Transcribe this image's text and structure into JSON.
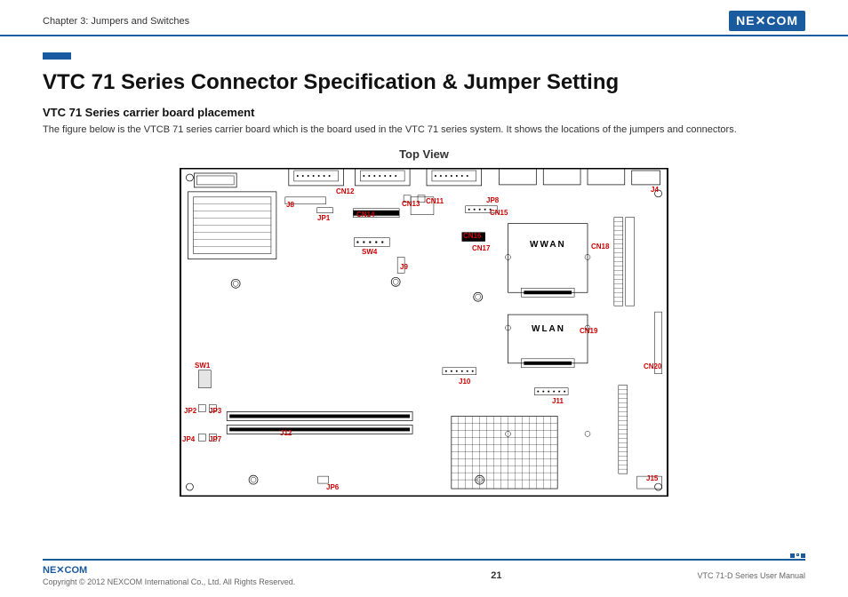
{
  "header": {
    "chapter_title": "Chapter 3: Jumpers and Switches",
    "logo_text": "NE✕COM"
  },
  "content": {
    "main_title": "VTC 71 Series Connector Specification & Jumper Setting",
    "subtitle": "VTC 71 Series carrier board placement",
    "description": "The figure below is the VTCB 71 series carrier board which is the board used in the VTC 71 series system. It shows the locations of the jumpers and connectors.",
    "top_view": "Top View"
  },
  "diagram": {
    "wwan": "WWAN",
    "wlan": "WLAN",
    "labels": {
      "cn12": "CN12",
      "cn13": "CN13",
      "cn11": "CN11",
      "cn14": "CN14",
      "cn15": "CN15",
      "cn16": "CN16",
      "cn17": "CN17",
      "cn18": "CN18",
      "cn19": "CN19",
      "cn20": "CN20",
      "j4": "J4",
      "j8": "J8",
      "j9": "J9",
      "j10": "J10",
      "j11": "J11",
      "j12": "J12",
      "j15": "J15",
      "jp1": "JP1",
      "jp2": "JP2",
      "jp3": "JP3",
      "jp4": "JP4",
      "jp6": "JP6",
      "jp7": "JP7",
      "jp8": "JP8",
      "sw1": "SW1",
      "sw4": "SW4"
    }
  },
  "footer": {
    "logo_text": "NE✕COM",
    "copyright": "Copyright © 2012 NEXCOM International Co., Ltd. All Rights Reserved.",
    "page": "21",
    "manual": "VTC 71-D Series User Manual"
  }
}
